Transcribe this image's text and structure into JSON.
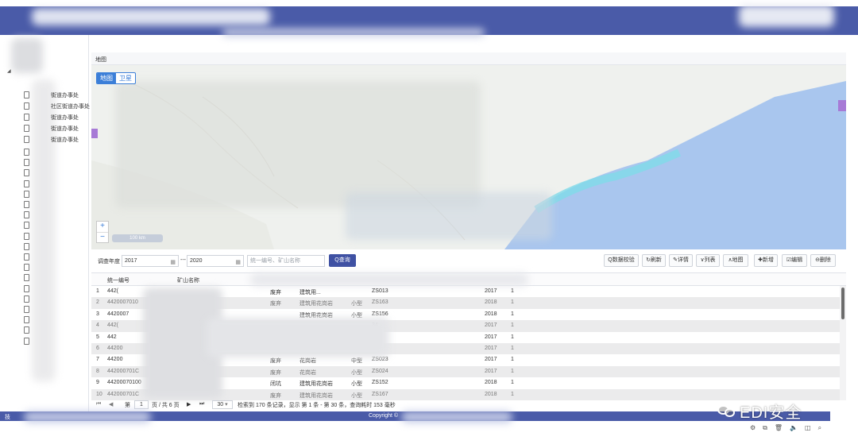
{
  "sidebar": {
    "items": [
      {
        "label": "街道办事处"
      },
      {
        "label": "社区街道办事处"
      },
      {
        "label": "街道办事处"
      },
      {
        "label": "街道办事处"
      },
      {
        "label": "街道办事处"
      }
    ]
  },
  "map_panel": {
    "title": "地图",
    "map_type": {
      "map_label": "地图",
      "satellite_label": "卫星"
    },
    "zoom_in": "+",
    "zoom_out": "−",
    "scale_label": "100 km"
  },
  "query": {
    "year_label": "调查年度",
    "year_from": "2017",
    "range_sep": "---",
    "year_to": "2020",
    "search_placeholder": "统一编号、矿山名称",
    "search_button": "Q查询",
    "calendar_glyph": "▦"
  },
  "actions": [
    {
      "label": "Q数据校验",
      "icon": "search-icon"
    },
    {
      "label": "↻刷新",
      "icon": "refresh-icon"
    },
    {
      "label": "✎详情",
      "icon": "detail-icon"
    },
    {
      "label": "∨列表",
      "icon": "chevron-down-icon"
    },
    {
      "label": "∧地图",
      "icon": "chevron-up-icon"
    },
    {
      "label": "✚新增",
      "icon": "plus-icon"
    },
    {
      "label": "☑编辑",
      "icon": "edit-icon"
    },
    {
      "label": "⊖删除",
      "icon": "delete-icon"
    }
  ],
  "table": {
    "headers": [
      "统一编号",
      "矿山名称"
    ],
    "rows": [
      {
        "num": "1",
        "code": "442(",
        "status": "废弃",
        "mineral": "建筑用...",
        "size": "",
        "zs": "ZS013",
        "year": "2017",
        "count": "1"
      },
      {
        "num": "2",
        "code": "4420007010",
        "status": "废弃",
        "mineral": "建筑用花岗岩",
        "size": "小型",
        "zs": "ZS163",
        "year": "2018",
        "count": "1"
      },
      {
        "num": "3",
        "code": "4420007",
        "status": "",
        "mineral": "建筑用花岗岩",
        "size": "小型",
        "zs": "ZS156",
        "year": "2018",
        "count": "1"
      },
      {
        "num": "4",
        "code": "442(",
        "status": "",
        "mineral": "",
        "size": "",
        "zs": "34",
        "year": "2017",
        "count": "1"
      },
      {
        "num": "5",
        "code": "442",
        "status": "",
        "mineral": "",
        "size": "",
        "zs": "",
        "year": "2017",
        "count": "1"
      },
      {
        "num": "6",
        "code": "44200",
        "status": "",
        "mineral": "",
        "size": "",
        "zs": "",
        "year": "2017",
        "count": "1"
      },
      {
        "num": "7",
        "code": "44200",
        "status": "废弃",
        "mineral": "花岗岩",
        "size": "中型",
        "zs": "ZS023",
        "year": "2017",
        "count": "1"
      },
      {
        "num": "8",
        "code": "442000701C",
        "status": "废弃",
        "mineral": "花岗岩",
        "size": "小型",
        "zs": "ZS024",
        "year": "2017",
        "count": "1"
      },
      {
        "num": "9",
        "code": "44200070100",
        "status": "闭坑",
        "mineral": "建筑用花岗岩",
        "size": "小型",
        "zs": "ZS152",
        "year": "2018",
        "count": "1"
      },
      {
        "num": "10",
        "code": "442000701C",
        "status": "废弃",
        "mineral": "建筑用花岗岩",
        "size": "小型",
        "zs": "ZS167",
        "year": "2018",
        "count": "1"
      }
    ]
  },
  "pager": {
    "first": "⏮",
    "prev": "◀",
    "page_word": "第",
    "page_input": "1",
    "page_of": "页 / 共 6 页",
    "next": "▶",
    "last": "⏭",
    "page_size": "30",
    "summary": "检索到 170 条记录，显示 第 1 条 - 第 30 条，查询耗时 153 毫秒"
  },
  "footer": {
    "left": "技",
    "copyright": "Copyright ©"
  },
  "watermark": {
    "text": "EDI安全"
  },
  "system_tray": [
    "⚙",
    "⧉",
    "🗑",
    "🔈",
    "◫",
    "⌕"
  ]
}
